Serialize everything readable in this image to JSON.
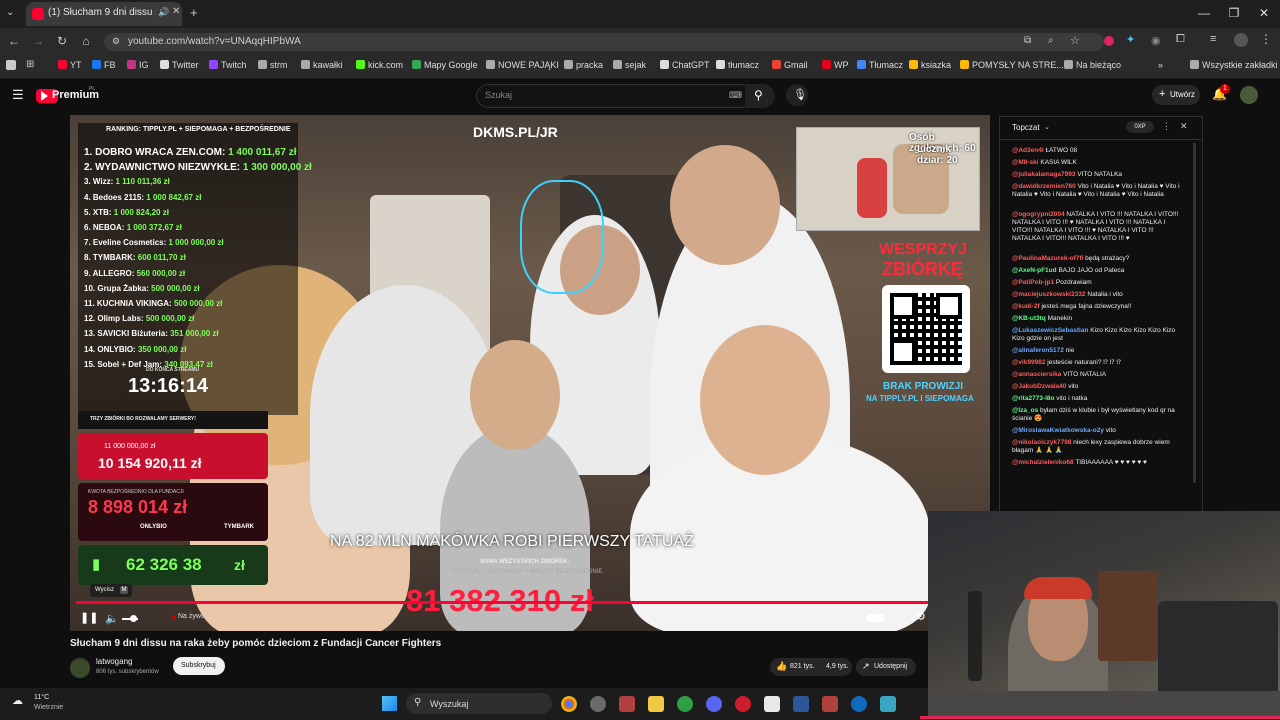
{
  "browser": {
    "tab_title": "(1) Słucham 9 dni dissu na raka",
    "url": "youtube.com/watch?v=UNAqqHIPbWA",
    "window_controls": [
      "—",
      "❐",
      "✕"
    ]
  },
  "bookmarks": [
    {
      "label": "YT",
      "color": "#ff0033"
    },
    {
      "label": "FB",
      "color": "#1877f2"
    },
    {
      "label": "IG",
      "color": "#c13584"
    },
    {
      "label": "Twitter",
      "color": "#dddddd"
    },
    {
      "label": "Twitch",
      "color": "#9146ff"
    },
    {
      "label": "strm",
      "color": "#aaaaaa"
    },
    {
      "label": "kawałki",
      "color": "#aaaaaa"
    },
    {
      "label": "kick.com",
      "color": "#53fc18"
    },
    {
      "label": "Mapy Google",
      "color": "#34a853"
    },
    {
      "label": "NOWE PAJĄKI",
      "color": "#aaaaaa"
    },
    {
      "label": "pracka",
      "color": "#aaaaaa"
    },
    {
      "label": "sejak",
      "color": "#aaaaaa"
    },
    {
      "label": "ChatGPT",
      "color": "#dddddd"
    },
    {
      "label": "tłumacz",
      "color": "#dddddd"
    },
    {
      "label": "Gmail",
      "color": "#ea4335"
    },
    {
      "label": "WP",
      "color": "#e2001a"
    },
    {
      "label": "Tłumacz",
      "color": "#4285f4"
    },
    {
      "label": "ksiazka",
      "color": "#fbbc05"
    },
    {
      "label": "POMYSŁY NA STRE...",
      "color": "#fbbc05"
    },
    {
      "label": "Na bieżąco",
      "color": "#aaaaaa"
    }
  ],
  "bookmarks_all": "Wszystkie zakładki",
  "youtube": {
    "logo_text": "Premium",
    "logo_region": "PL",
    "search_placeholder": "Szukaj",
    "create_label": "Utwórz",
    "notification_count": "1"
  },
  "video": {
    "ranking_header": "RANKING:   TIPPLY.PL + SIEPOMAGA + BEZPOŚREDNIE",
    "ranking": [
      {
        "text": "1. DOBRO WRACA ZEN.COM:",
        "amount": "1 400 011,67 zł"
      },
      {
        "text": "2. WYDAWNICTWO NIEZWYKŁE:",
        "amount": "1 300 000,00 zł"
      },
      {
        "text": "3. Wizz:",
        "amount": "1 110 011,36 zł"
      },
      {
        "text": "4. Bedoes 2115:",
        "amount": "1 000 842,67 zł"
      },
      {
        "text": "5. XTB:",
        "amount": "1 000 824,20 zł"
      },
      {
        "text": "6. NEBOA:",
        "amount": "1 000 372,67 zł"
      },
      {
        "text": "7. Eveline Cosmetics:",
        "amount": "1 000 000,00 zł"
      },
      {
        "text": "8. TYMBARK:",
        "amount": "600 011,70 zł"
      },
      {
        "text": "9. ALLEGRO:",
        "amount": "560 000,00 zł"
      },
      {
        "text": "10. Grupa Żabka:",
        "amount": "500 000,00 zł"
      },
      {
        "text": "11. KUCHNIA VIKINGA:",
        "amount": "500 000,00 zł"
      },
      {
        "text": "12. Olimp Labs:",
        "amount": "500 000,00 zł"
      },
      {
        "text": "13. SAVICKI Biżuteria:",
        "amount": "351 000,00 zł"
      },
      {
        "text": "14. ONLYBIO:",
        "amount": "350 000,00 zł"
      },
      {
        "text": "15. Sobel + Def Jam:",
        "amount": "340 093,47 zł"
      }
    ],
    "countdown_label": "DO KOŃCA STREAMU",
    "countdown": "13:16:14",
    "fund_header": "TRZY ZBIÓRKI BO ROZWALAMY SERWERY!",
    "goal": "11 000 000,00 zł",
    "collected": "10 154 920,11 zł",
    "direct_label": "KWOTA BEZPOŚREDNIO DLA FUNDACJI",
    "direct_amount": "8 898 014 zł",
    "direct_sponsors": [
      "ONLYBIO",
      "TYMBARK"
    ],
    "green_amount": "62 326 38",
    "green_suffix": "zł",
    "wycisz_tooltip": "Wycisz",
    "wycisz_key": "M",
    "top_banner": "DKMS.PL/JR",
    "wesprzyj": "WESPRZYJ",
    "zbiorke": "ZBIÓRKĘ",
    "brak_prowizji": "BRAK PROWIZJI",
    "na_tipply": "NA TIPPLY.PL I SIEPOMAGA",
    "inset_line1": "Osób zgolonych: 60",
    "inset_line2": "Licznik dziar: 20",
    "subtitle": "NA 82 MLN MAKÓWKA ROBI PIERWSZY TATUAŻ",
    "total_label": "SUMA WSZYSTKICH ZBIÓREK:",
    "total_sub": "TIPPLY.PL + SIEPOMAGA + WPŁATY BEZPOŚREDNIE",
    "total_amount": "81 382 310 zł",
    "live_label": "Na żywo",
    "progress": 1.0
  },
  "video_title": "Słucham 9 dni dissu na raka żeby pomóc dzieciom z Fundacji Cancer Fighters",
  "channel": {
    "name": "latwogang",
    "subs": "806 tys. subskrybentów",
    "subscribe_label": "Subskrybuj",
    "likes": "821 tys.",
    "likes2": "4,9 tys.",
    "share_label": "Udostępnij"
  },
  "chat": {
    "title": "Topczat",
    "badge": "0XP",
    "messages": [
      {
        "name": "@Ad3en4l",
        "text": "ŁATWO 08",
        "color": "#ff5c5c"
      },
      {
        "name": "@M8-ski",
        "text": "KASIA WILK",
        "color": "#ff5c5c"
      },
      {
        "name": "@juliakalamaga7993",
        "text": "VITO NATALKa",
        "color": "#ff5c5c"
      },
      {
        "name": "@dawidkrzemien760",
        "text": "Vito i Natalia ♥ Vito i Natalia ♥ Vito i Natalia ♥ Vito i Natalia ♥ Vito i Natalia ♥ Vito i Natalia",
        "color": "#ff5c5c"
      },
      {
        "name": "@ogogrypni2004",
        "text": "NATALKA I VITO !!! NATALKA I VITO!!! NATALKA I VITO !!! ♥ NATALKA I VITO !!! NATALKA I VITO!!! NATALKA I VITO !!! ♥ NATALKA I VITO !!! NATALKA I VITO!!! NATALKA I VITO !!! ♥",
        "color": "#ff5c5c"
      },
      {
        "name": "@PaulinaMazurek-of7fi",
        "text": "będą strażacy?",
        "color": "#ff5c5c"
      },
      {
        "name": "@AxeN-pF1ud",
        "text": "BAJO JAJO od Pateca",
        "color": "#5cff8a"
      },
      {
        "name": "@PatiPob-jp1",
        "text": "Pozdrawiam",
        "color": "#ff5c5c"
      },
      {
        "name": "@maciejuszkowski2332",
        "text": "Natalia i vito",
        "color": "#ff5c5c"
      },
      {
        "name": "@kudi-2f",
        "text": "jesteś mega fajna dziewczyna!!",
        "color": "#ff5c5c"
      },
      {
        "name": "@KB-ut3tq",
        "text": "Manekin",
        "color": "#5cff8a"
      },
      {
        "name": "@LukaszewiczSebastian",
        "text": "Kizo Kizo Kizo Kizo Kizo Kizo Kizo gdzie on jest",
        "color": "#6aa8ff"
      },
      {
        "name": "@alinaferon5172",
        "text": "nie",
        "color": "#6aa8ff"
      },
      {
        "name": "@vik99982",
        "text": "jesteście naturani? ⁉ ⁉ ⁉",
        "color": "#ff5c5c"
      },
      {
        "name": "@annasciersika",
        "text": "VITO NATALIA",
        "color": "#ff5c5c"
      },
      {
        "name": "@JakubDzwala40",
        "text": "vito",
        "color": "#ff5c5c"
      },
      {
        "name": "@rita2773-l8o",
        "text": "vito i natka",
        "color": "#5cff8a"
      },
      {
        "name": "@Iza_os",
        "text": "byłam dziś w klubie i był wyświetlany kod qr na ścianie 😍",
        "color": "#5cff8a"
      },
      {
        "name": "@MiroslawaKwiatkowska-o2y",
        "text": "vito",
        "color": "#6aa8ff"
      },
      {
        "name": "@nikolaolczyk7798",
        "text": "niech lexy zaspiewa dobrze wiem błagam 🙏 🙏 🙏",
        "color": "#ff5c5c"
      },
      {
        "name": "@michalzieleniko68",
        "text": "TIBIAAAAAA ♥ ♥ ♥ ♥ ♥ ♥",
        "color": "#ff5c5c"
      }
    ]
  },
  "taskbar": {
    "temp": "11°C",
    "weather": "Wietrznie",
    "search": "Wyszukaj"
  },
  "colors": {
    "accent": "#ff0033",
    "green": "#7dff5a"
  }
}
